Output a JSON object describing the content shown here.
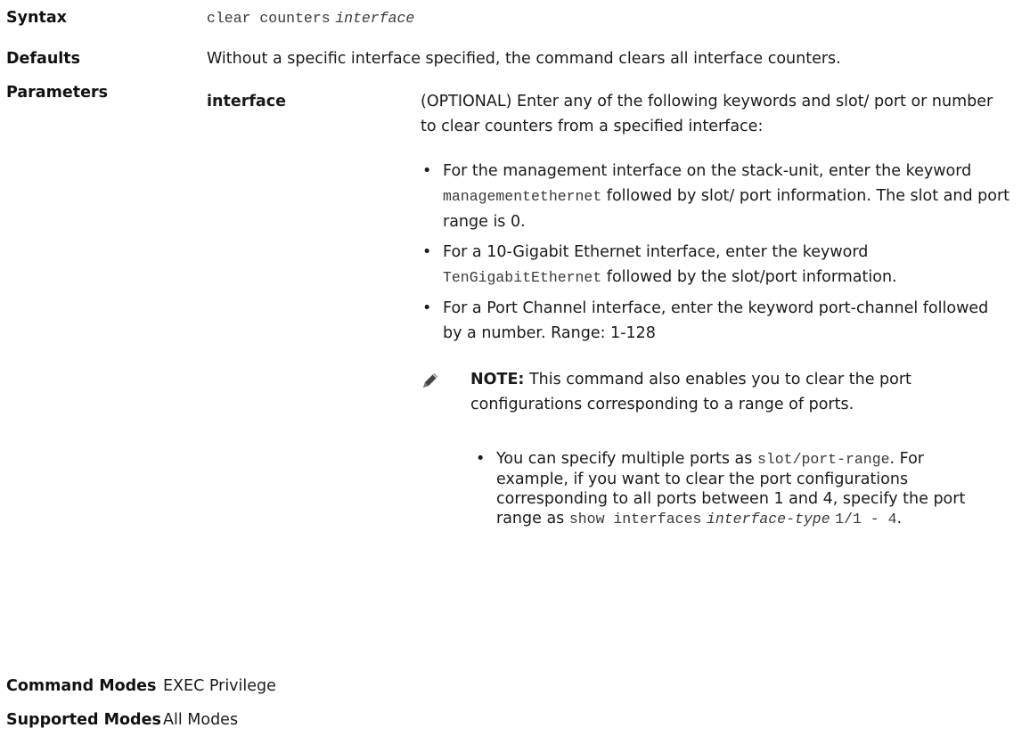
{
  "syntax": {
    "label": "Syntax",
    "command": "clear counters",
    "arg": "interface"
  },
  "defaults": {
    "label": "Defaults",
    "text": "Without a specific interface specified, the command clears all interface counters."
  },
  "parameters": {
    "label": "Parameters",
    "name": "interface",
    "description": "(OPTIONAL) Enter any of the following keywords and slot/ port or number to clear counters from a specified interface:",
    "bullets": [
      {
        "pre": "For the management interface on the stack-unit, enter the keyword ",
        "code": "managementethernet",
        "post": " followed by slot/ port information. The slot and port range is 0."
      },
      {
        "pre": "For a 10-Gigabit Ethernet interface, enter the keyword ",
        "code": "TenGigabitEthernet",
        "post": " followed by the slot/port information."
      },
      {
        "pre": "For a Port Channel interface, enter the keyword port-channel followed by a number. Range: 1-128",
        "code": "",
        "post": ""
      }
    ],
    "note": {
      "label": "NOTE:",
      "text": " This command also enables you to clear the port configurations corresponding to a range of ports.",
      "sub": {
        "pre": "You can specify multiple ports as ",
        "code1": "slot/port-range",
        "mid": ". For example, if you want to clear the port configurations corresponding to all ports between 1 and 4, specify the port range as ",
        "code2": "show interfaces",
        "code3": "interface-type",
        "code4": "1/1 - 4",
        "end": "."
      }
    }
  },
  "command_modes": {
    "label": "Command Modes",
    "value": "EXEC Privilege"
  },
  "supported_modes": {
    "label": "Supported Modes",
    "value": "All Modes"
  },
  "icons": {
    "note": "pencil-note-icon"
  }
}
